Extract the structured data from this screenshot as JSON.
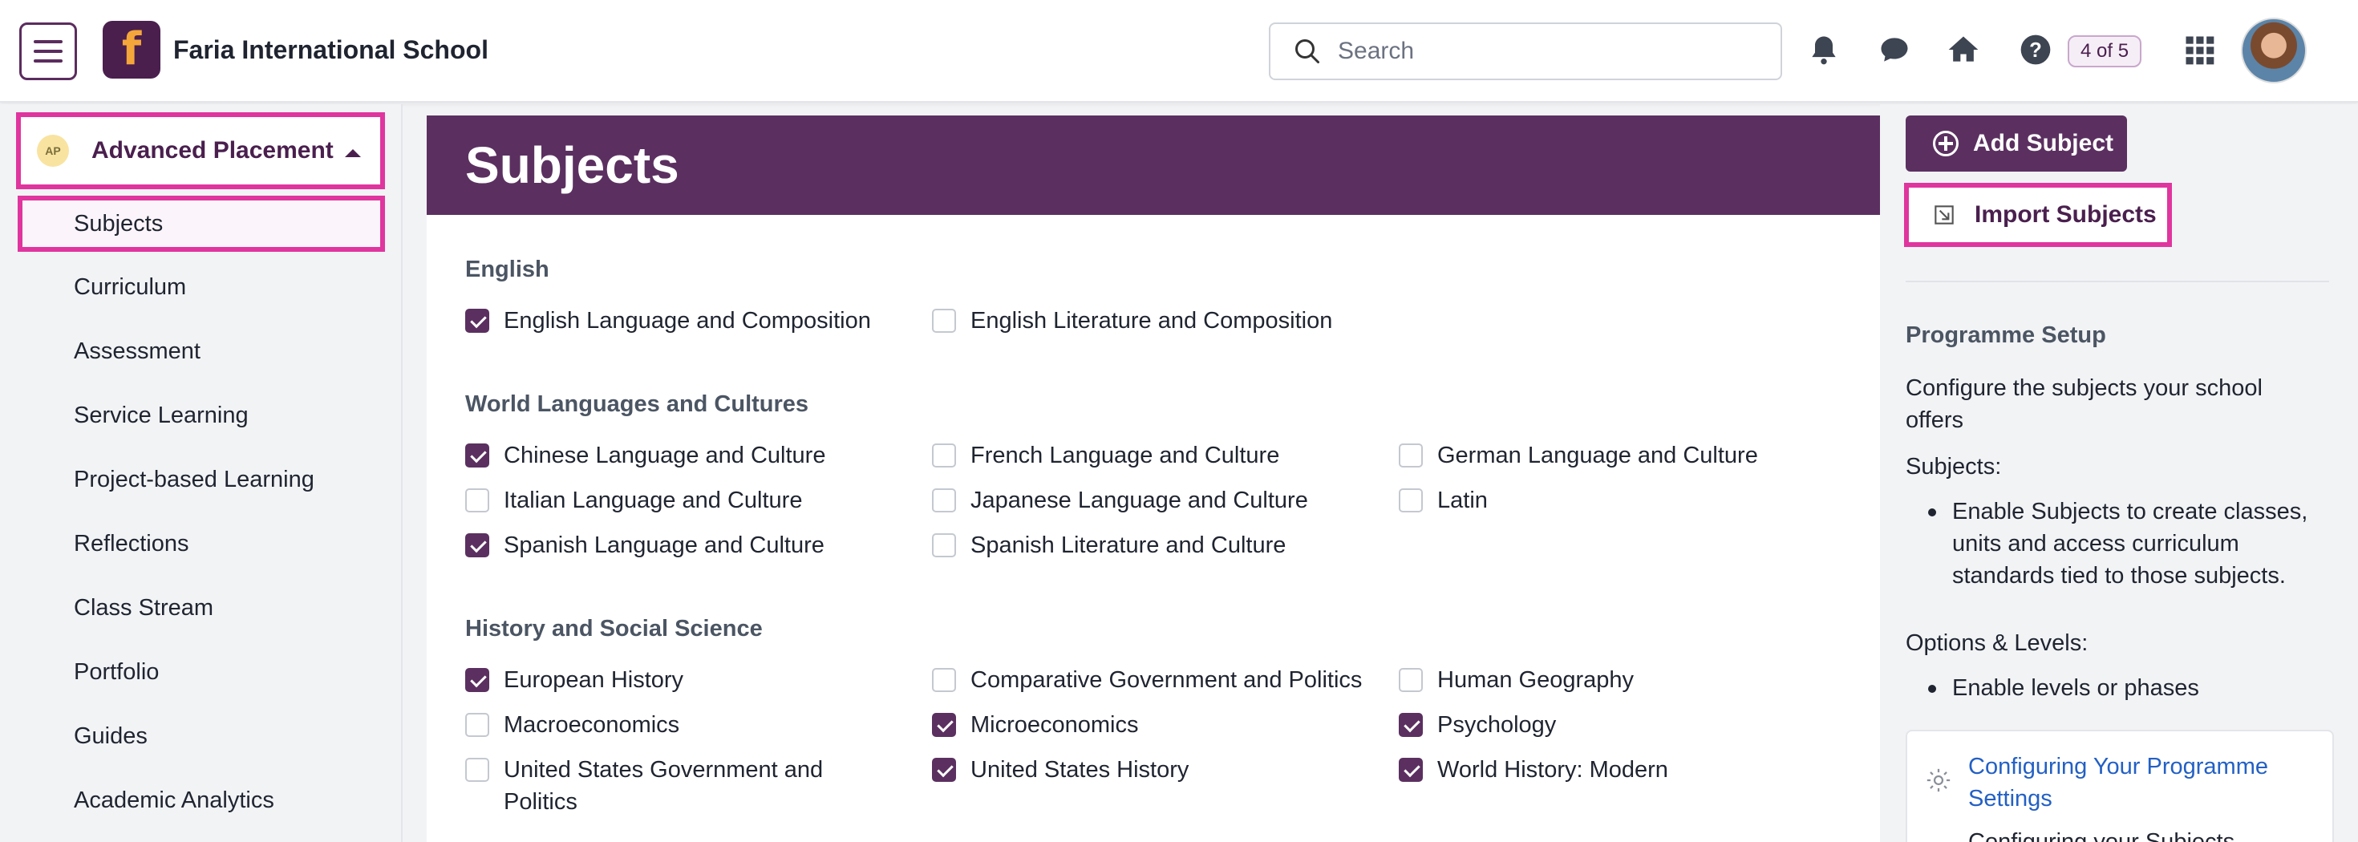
{
  "header": {
    "school_name": "Faria International School",
    "search_placeholder": "Search",
    "counter": "4 of 5"
  },
  "sidebar": {
    "programme": "Advanced Placement",
    "active_item": "Subjects",
    "items": [
      "Curriculum",
      "Assessment",
      "Service Learning",
      "Project-based Learning",
      "Reflections",
      "Class Stream",
      "Portfolio",
      "Guides",
      "Academic Analytics"
    ]
  },
  "main": {
    "title": "Subjects",
    "sections": [
      {
        "title": "English",
        "options": [
          {
            "label": "English Language and Composition",
            "checked": true
          },
          {
            "label": "English Literature and Composition",
            "checked": false
          }
        ]
      },
      {
        "title": "World Languages and Cultures",
        "options": [
          {
            "label": "Chinese Language and Culture",
            "checked": true
          },
          {
            "label": "French Language and Culture",
            "checked": false
          },
          {
            "label": "German Language and Culture",
            "checked": false
          },
          {
            "label": "Italian Language and Culture",
            "checked": false
          },
          {
            "label": "Japanese Language and Culture",
            "checked": false
          },
          {
            "label": "Latin",
            "checked": false
          },
          {
            "label": "Spanish Language and Culture",
            "checked": true
          },
          {
            "label": "Spanish Literature and Culture",
            "checked": false
          }
        ]
      },
      {
        "title": "History and Social Science",
        "options": [
          {
            "label": "European History",
            "checked": true
          },
          {
            "label": "Comparative Government and Politics",
            "checked": false
          },
          {
            "label": "Human Geography",
            "checked": false
          },
          {
            "label": "Macroeconomics",
            "checked": false
          },
          {
            "label": "Microeconomics",
            "checked": true
          },
          {
            "label": "Psychology",
            "checked": true
          },
          {
            "label": "United States Government and Politics",
            "checked": false
          },
          {
            "label": "United States History",
            "checked": true
          },
          {
            "label": "World History: Modern",
            "checked": true
          }
        ]
      }
    ]
  },
  "right_panel": {
    "add_label": "Add Subject",
    "import_label": "Import Subjects",
    "setup_title": "Programme Setup",
    "setup_desc": "Configure the subjects your school offers",
    "subjects_heading": "Subjects:",
    "subjects_bullet": "Enable Subjects to create classes, units and access curriculum standards tied to those subjects.",
    "options_heading": "Options & Levels:",
    "options_bullet": "Enable levels or phases",
    "help_link": "Configuring Your Programme Settings",
    "help_sub": "Configuring your Subjects"
  },
  "colors": {
    "primary": "#5b3060",
    "highlight": "#e0359e",
    "link": "#2360c4"
  }
}
